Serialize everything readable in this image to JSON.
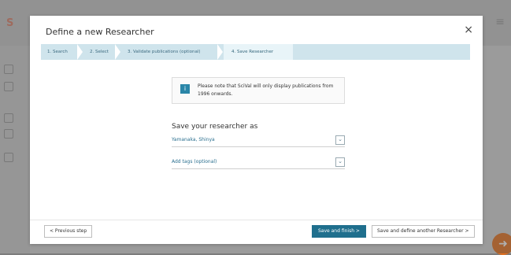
{
  "background": {
    "logo_text": "S",
    "menu_icon": "menu-icon"
  },
  "modal": {
    "title": "Define a new Researcher",
    "close_icon": "×",
    "steps": [
      {
        "label": "1. Search"
      },
      {
        "label": "2. Select"
      },
      {
        "label": "3. Validate publications (optional)"
      },
      {
        "label": "4. Save Researcher"
      }
    ],
    "notice": {
      "icon": "i",
      "text": "Please note that SciVal will only display publications from 1996 onwards."
    },
    "save_label": "Save your researcher as",
    "name_field_value": "Yamanaka, Shinya",
    "tags_field_value": "Add tags (optional)",
    "buttons": {
      "previous": "< Previous step",
      "finish": "Save and finish  >",
      "another": "Save and define another Researcher  >"
    }
  },
  "colors": {
    "accent": "#1f6f8d",
    "step_bar": "#cfe4ec",
    "logo_orange": "#e0826a"
  }
}
